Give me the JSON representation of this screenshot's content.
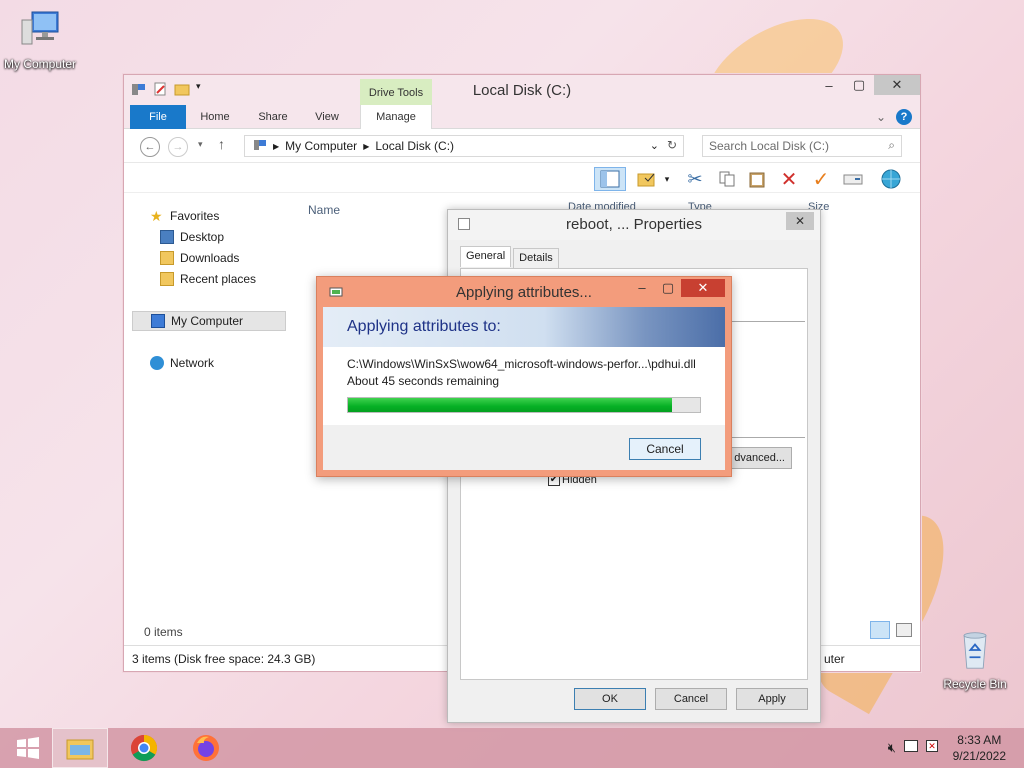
{
  "desktop": {
    "my_computer_label": "My Computer",
    "recycle_bin_label": "Recycle Bin"
  },
  "explorer": {
    "title": "Local Disk (C:)",
    "contextual_tab_group": "Drive Tools",
    "tabs": {
      "file": "File",
      "home": "Home",
      "share": "Share",
      "view": "View",
      "manage": "Manage"
    },
    "breadcrumb": [
      "My Computer",
      "Local Disk (C:)"
    ],
    "search_placeholder": "Search Local Disk (C:)",
    "navigation": {
      "favorites": "Favorites",
      "desktop": "Desktop",
      "downloads": "Downloads",
      "recent": "Recent places",
      "my_computer": "My Computer",
      "network": "Network"
    },
    "columns": {
      "name": "Name",
      "date_modified": "Date modified",
      "type": "Type",
      "size": "Size"
    },
    "empty_items": "0 items",
    "status": "3 items (Disk free space: 24.3 GB)",
    "status_right": "uter"
  },
  "properties": {
    "title": "reboot, ... Properties",
    "tabs": [
      "General",
      "Details"
    ],
    "advanced_label": "Advanced...",
    "advanced_visible": "dvanced...",
    "hidden_label": "Hidden",
    "hidden_checked": true,
    "ok": "OK",
    "cancel": "Cancel",
    "apply": "Apply"
  },
  "apply_dialog": {
    "title": "Applying attributes...",
    "heading": "Applying attributes to:",
    "file_path": "C:\\Windows\\WinSxS\\wow64_microsoft-windows-perfor...\\pdhui.dll",
    "remaining": "About 45 seconds remaining",
    "progress_percent": 92,
    "cancel": "Cancel"
  },
  "taskbar": {
    "time": "8:33 AM",
    "date": "9/21/2022"
  },
  "colors": {
    "accent": "#1979ca",
    "progress": "#06b025",
    "dialog_frame": "#f39c7c"
  }
}
